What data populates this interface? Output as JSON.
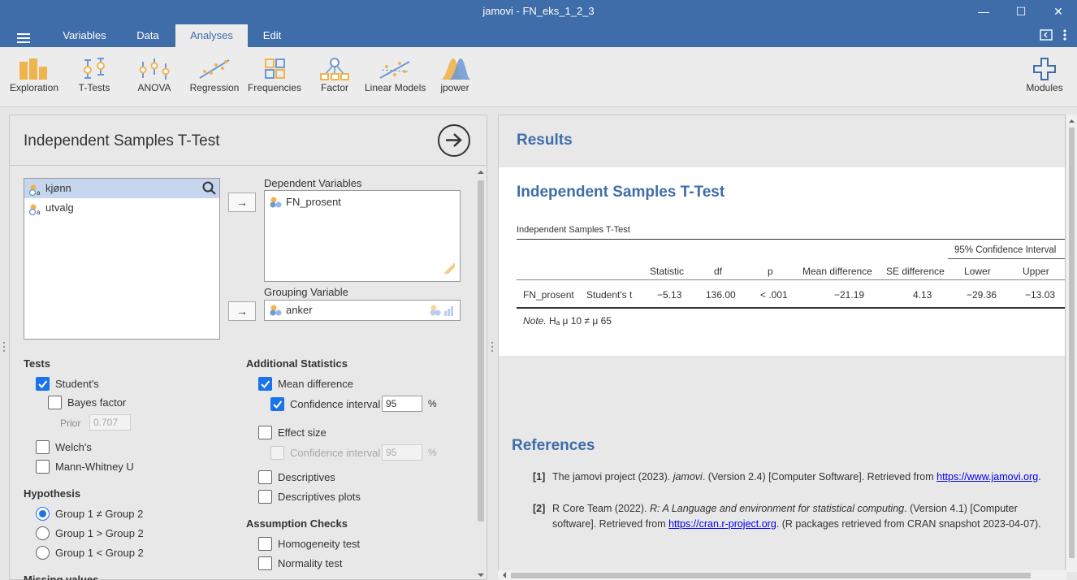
{
  "window": {
    "title": "jamovi - FN_eks_1_2_3",
    "minimize": "—",
    "maximize": "☐",
    "close": "✕"
  },
  "menu": {
    "tabs": [
      {
        "label": "Variables"
      },
      {
        "label": "Data"
      },
      {
        "label": "Analyses"
      },
      {
        "label": "Edit"
      }
    ],
    "active_tab": "Analyses"
  },
  "ribbon": {
    "items": [
      {
        "label": "Exploration",
        "icon": "exploration-icon"
      },
      {
        "label": "T-Tests",
        "icon": "ttests-icon"
      },
      {
        "label": "ANOVA",
        "icon": "anova-icon"
      },
      {
        "label": "Regression",
        "icon": "regression-icon"
      },
      {
        "label": "Frequencies",
        "icon": "frequencies-icon"
      },
      {
        "label": "Factor",
        "icon": "factor-icon"
      },
      {
        "label": "Linear Models",
        "icon": "linear-models-icon"
      },
      {
        "label": "jpower",
        "icon": "jpower-icon"
      }
    ],
    "modules_label": "Modules"
  },
  "options": {
    "title": "Independent Samples T-Test",
    "variables": [
      {
        "name": "kjønn",
        "selected": true
      },
      {
        "name": "utvalg",
        "selected": false
      }
    ],
    "dependent_label": "Dependent Variables",
    "dependent_vars": [
      "FN_prosent"
    ],
    "grouping_label": "Grouping Variable",
    "grouping_var": "anker",
    "arrow": "→",
    "tests": {
      "heading": "Tests",
      "students": "Student's",
      "bayes": "Bayes factor",
      "prior_label": "Prior",
      "prior_value": "0.707",
      "welch": "Welch's",
      "mann_whitney": "Mann-Whitney U"
    },
    "hypothesis": {
      "heading": "Hypothesis",
      "opt1": "Group 1 ≠ Group 2",
      "opt2": "Group 1 > Group 2",
      "opt3": "Group 1 < Group 2"
    },
    "missing_heading": "Missing values",
    "additional": {
      "heading": "Additional Statistics",
      "mean_diff": "Mean difference",
      "ci": "Confidence interval",
      "ci_value": "95",
      "percent": "%",
      "effect_size": "Effect size",
      "es_ci": "Confidence interval",
      "es_ci_value": "95",
      "descriptives": "Descriptives",
      "descriptives_plots": "Descriptives plots"
    },
    "assumptions": {
      "heading": "Assumption Checks",
      "homogeneity": "Homogeneity test",
      "normality": "Normality test"
    }
  },
  "results": {
    "heading": "Results",
    "title": "Independent Samples T-Test",
    "table": {
      "caption": "Independent Samples T-Test",
      "ci_header": "95% Confidence Interval",
      "columns": [
        "Statistic",
        "df",
        "p",
        "Mean difference",
        "SE difference",
        "Lower",
        "Upper"
      ],
      "row": {
        "variable": "FN_prosent",
        "test": "Student's t",
        "statistic": "−5.13",
        "df": "136.00",
        "p": "< .001",
        "mean_diff": "−21.19",
        "se_diff": "4.13",
        "lower": "−29.36",
        "upper": "−13.03"
      },
      "note_label": "Note.",
      "note_text": "Hₐ μ 10 ≠ μ 65"
    },
    "references": {
      "heading": "References",
      "items": [
        {
          "num": "[1]",
          "text_before": "The jamovi project (2023). ",
          "italic": "jamovi",
          "text_after": ". (Version 2.4) [Computer Software]. Retrieved from ",
          "link": "https://www.jamovi.org",
          "end": "."
        },
        {
          "num": "[2]",
          "text_before": "R Core Team (2022). ",
          "italic": "R: A Language and environment for statistical computing",
          "text_after": ". (Version 4.1) [Computer software]. Retrieved from ",
          "link": "https://cran.r-project.org",
          "end": ". (R packages retrieved from CRAN snapshot 2023-04-07)."
        }
      ]
    }
  },
  "colors": {
    "brand": "#3e6da9",
    "checkbox": "#1a73e8",
    "icon_orange": "#f0b44c",
    "icon_blue": "#6b98d6"
  }
}
